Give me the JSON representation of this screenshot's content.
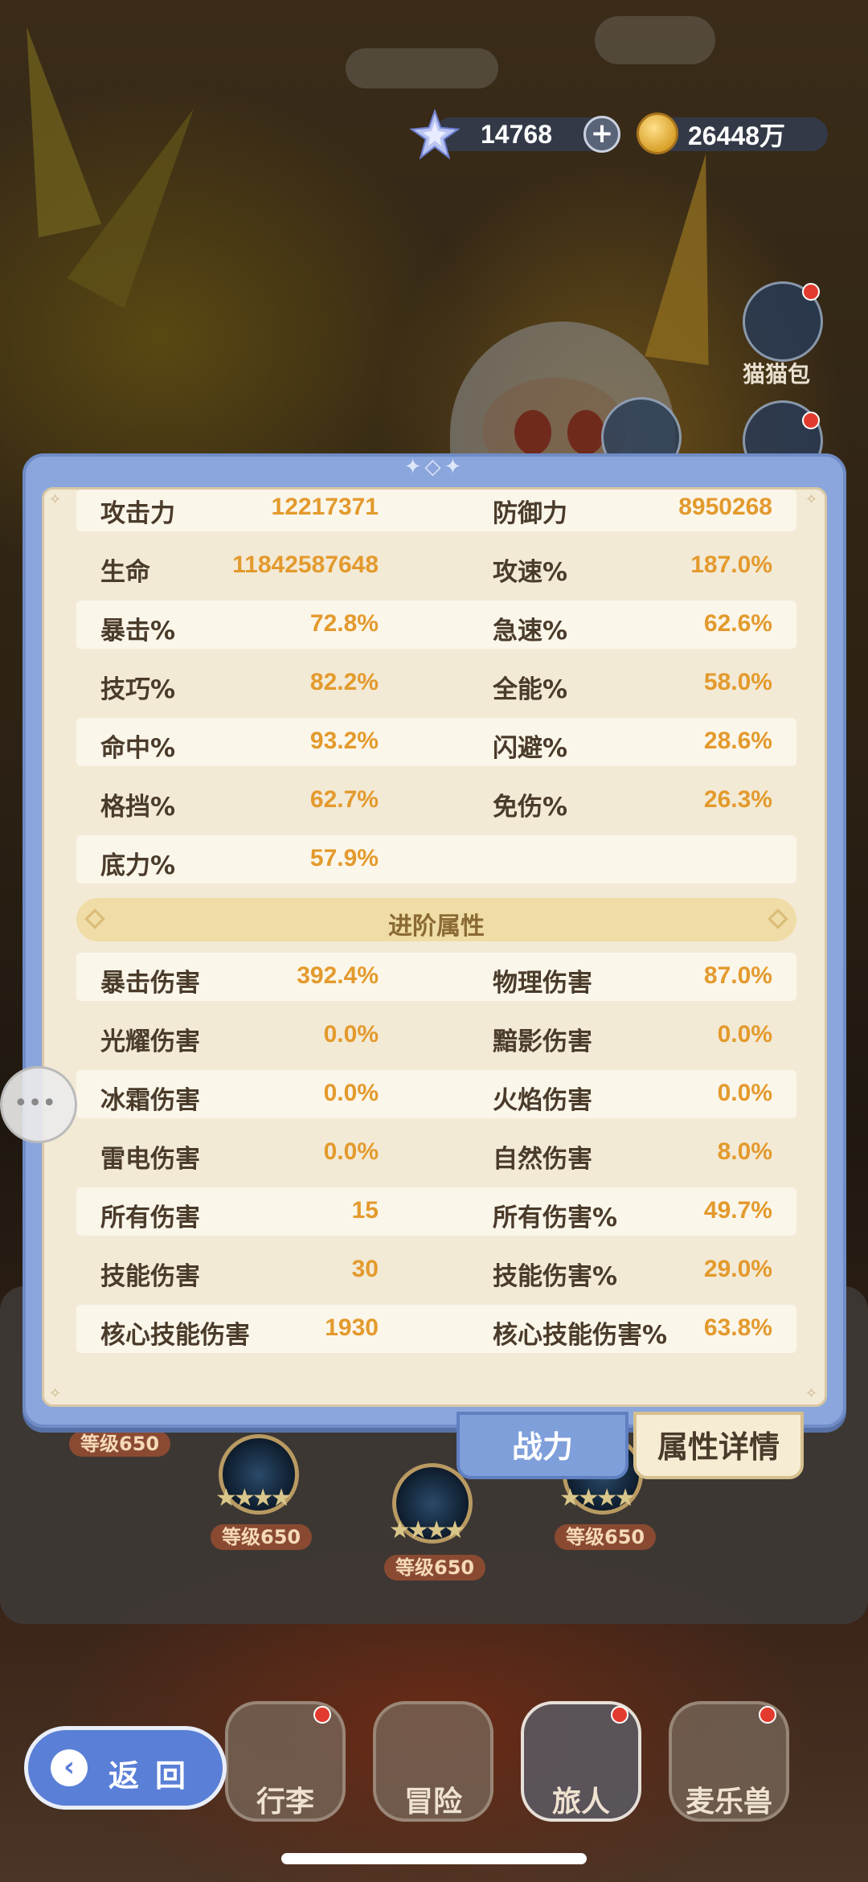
{
  "currency": {
    "gems": "14768",
    "coins": "26448万",
    "gem_icon": "crystal-star",
    "coin_icon": "gold-coin",
    "add_icon": "plus"
  },
  "side": {
    "cat_bag_label": "猫猫包"
  },
  "stats": {
    "basic": [
      {
        "l1": "攻击力",
        "v1": "12217371",
        "l2": "防御力",
        "v2": "8950268"
      },
      {
        "l1": "生命",
        "v1": "11842587648",
        "l2": "攻速%",
        "v2": "187.0%"
      },
      {
        "l1": "暴击%",
        "v1": "72.8%",
        "l2": "急速%",
        "v2": "62.6%"
      },
      {
        "l1": "技巧%",
        "v1": "82.2%",
        "l2": "全能%",
        "v2": "58.0%"
      },
      {
        "l1": "命中%",
        "v1": "93.2%",
        "l2": "闪避%",
        "v2": "28.6%"
      },
      {
        "l1": "格挡%",
        "v1": "62.7%",
        "l2": "免伤%",
        "v2": "26.3%"
      },
      {
        "l1": "底力%",
        "v1": "57.9%",
        "l2": "",
        "v2": ""
      }
    ],
    "advanced_title": "进阶属性",
    "advanced": [
      {
        "l1": "暴击伤害",
        "v1": "392.4%",
        "l2": "物理伤害",
        "v2": "87.0%"
      },
      {
        "l1": "光耀伤害",
        "v1": "0.0%",
        "l2": "黯影伤害",
        "v2": "0.0%"
      },
      {
        "l1": "冰霜伤害",
        "v1": "0.0%",
        "l2": "火焰伤害",
        "v2": "0.0%"
      },
      {
        "l1": "雷电伤害",
        "v1": "0.0%",
        "l2": "自然伤害",
        "v2": "8.0%"
      },
      {
        "l1": "所有伤害",
        "v1": "15",
        "l2": "所有伤害%",
        "v2": "49.7%"
      },
      {
        "l1": "技能伤害",
        "v1": "30",
        "l2": "技能伤害%",
        "v2": "29.0%"
      },
      {
        "l1": "核心技能伤害",
        "v1": "1930",
        "l2": "核心技能伤害%",
        "v2": "63.8%"
      }
    ]
  },
  "tabs": {
    "power": "战力",
    "details": "属性详情"
  },
  "levels": {
    "tag1": "等级650",
    "tag2": "等级650",
    "tag3": "等级650",
    "tag4": "等级650"
  },
  "nav": {
    "back": "返回",
    "luggage": "行李",
    "adventure": "冒险",
    "traveler": "旅人",
    "pet": "麦乐兽"
  },
  "colors": {
    "panel_blue": "#8aa6dc",
    "value_orange": "#e39a2d",
    "label_brown": "#4a3b2a"
  }
}
